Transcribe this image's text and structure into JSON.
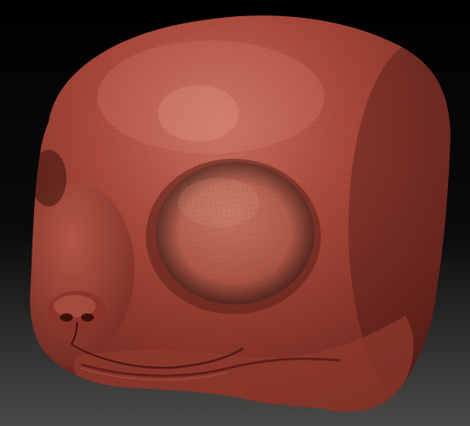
{
  "scene": {
    "subject": "sculpt-head",
    "colors": {
      "background_top": "#000000",
      "background_bottom": "#4a4a4a",
      "material_base": "#9a3f33",
      "material_light": "#c76a5b",
      "material_dark": "#5a1f18",
      "mesh_line": "#6b2a22"
    }
  }
}
